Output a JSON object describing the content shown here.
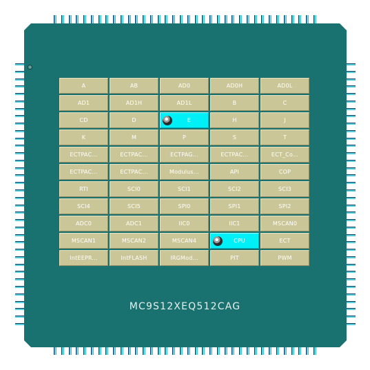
{
  "chip": {
    "part_number": "MC9S12XEQ512CAG",
    "body_color": "#1a7270",
    "module_color": "#cbc697",
    "active_color": "#00f0f8",
    "pin_color": "#1fb7c8"
  },
  "modules": [
    [
      "A",
      "AB",
      "AD0",
      "AD0H",
      "AD0L"
    ],
    [
      "AD1",
      "AD1H",
      "AD1L",
      "B",
      "C"
    ],
    [
      "CD",
      "D",
      "E",
      "H",
      "J"
    ],
    [
      "K",
      "M",
      "P",
      "S",
      "T"
    ],
    [
      "ECTPAC...",
      "ECTPAC...",
      "ECTPAG...",
      "ECTPAC...",
      "ECT_Co..."
    ],
    [
      "ECTPAC...",
      "ECTPAC...",
      "Modulus...",
      "API",
      "COP"
    ],
    [
      "RTI",
      "SCI0",
      "SCI1",
      "SCI2",
      "SCI3"
    ],
    [
      "SCI4",
      "SCI5",
      "SPI0",
      "SPI1",
      "SPI2"
    ],
    [
      "ADC0",
      "ADC1",
      "IIC0",
      "IIC1",
      "MSCAN0"
    ],
    [
      "MSCAN1",
      "MSCAN2",
      "MSCAN4",
      "CPU",
      "ECT"
    ],
    [
      "IntEEPR...",
      "IntFLASH",
      "IRGMod...",
      "PIT",
      "PWM"
    ]
  ],
  "active_modules": [
    "E",
    "CPU"
  ]
}
